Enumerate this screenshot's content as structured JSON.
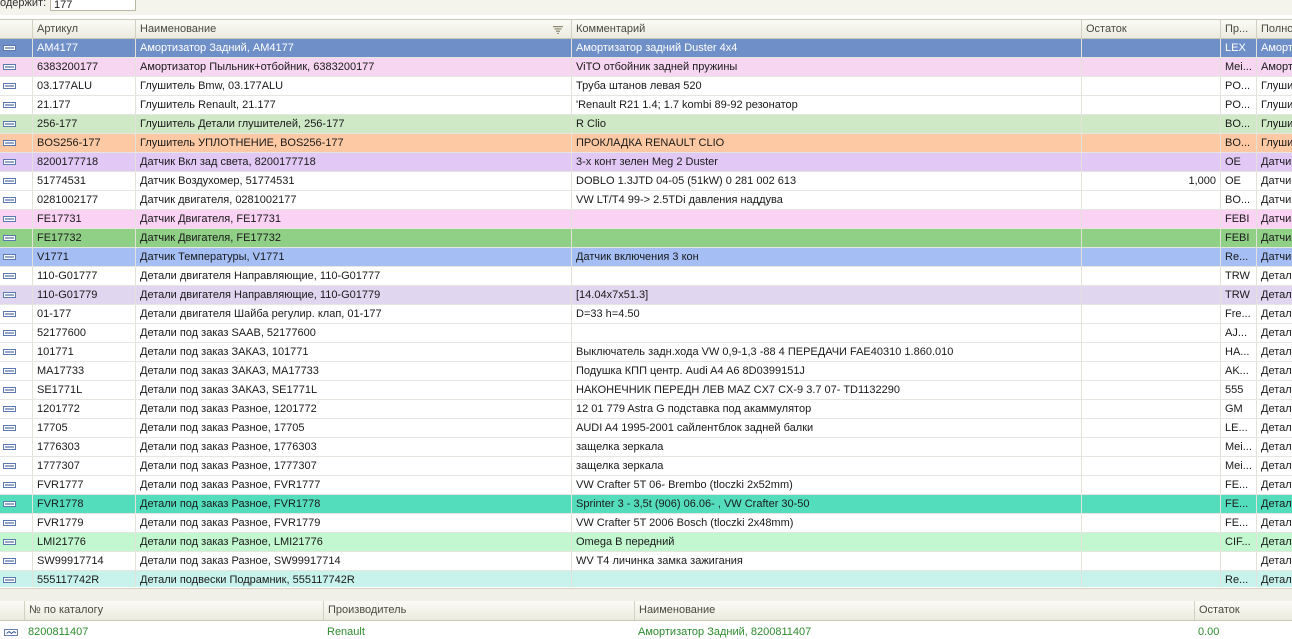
{
  "filter": {
    "label": "одержит:",
    "value": "177"
  },
  "columns": [
    "Артикул",
    "Наименование",
    "Комментарий",
    "Остаток",
    "Пр...",
    "Полно"
  ],
  "rows": [
    {
      "art": "AM4177",
      "name": "Амортизатор Задний, AM4177",
      "comment": "Амортизатор задний Duster 4x4",
      "stock": "",
      "mfr": "LEX",
      "full": "Аморт",
      "color": "#6f8fc8",
      "selected": true
    },
    {
      "art": "6383200177",
      "name": "Амортизатор Пыльник+отбойник, 6383200177",
      "comment": "ViTO отбойник задней пружины",
      "stock": "",
      "mfr": "Mei...",
      "full": "Аморт",
      "color": "#f6d6f1"
    },
    {
      "art": "03.177ALU",
      "name": "Глушитель Bmw, 03.177ALU",
      "comment": "Труба штанов левая 520",
      "stock": "",
      "mfr": "PO...",
      "full": "Глуши",
      "color": "#ffffff"
    },
    {
      "art": "21.177",
      "name": "Глушитель Renault, 21.177",
      "comment": "'Renault R21 1.4; 1.7 kombi  89-92 резонатор",
      "stock": "",
      "mfr": "PO...",
      "full": "Глуши",
      "color": "#ffffff"
    },
    {
      "art": "256-177",
      "name": "Глушитель Детали глушителей, 256-177",
      "comment": "R Clio",
      "stock": "",
      "mfr": "BO...",
      "full": "Глуши",
      "color": "#cfe8c6"
    },
    {
      "art": "BOS256-177",
      "name": "Глушитель УПЛОТНЕНИЕ, BOS256-177",
      "comment": "ПРОКЛАДКА RENAULT CLIO",
      "stock": "",
      "mfr": "BO...",
      "full": "Глуши",
      "color": "#fdc9a4"
    },
    {
      "art": "8200177718",
      "name": "Датчик Вкл зад света, 8200177718",
      "comment": "3-х конт зелен Meg 2  Duster",
      "stock": "",
      "mfr": "OE",
      "full": "Датчи",
      "color": "#e2c9f5"
    },
    {
      "art": "51774531",
      "name": "Датчик Воздухомер, 51774531",
      "comment": "DOBLO 1.3JTD 04-05 (51kW) 0 281 002 613",
      "stock": "1,000",
      "mfr": "OE",
      "full": "Датчи",
      "color": "#ffffff"
    },
    {
      "art": "0281002177",
      "name": "Датчик двигателя, 0281002177",
      "comment": "VW LT/T4  99-> 2.5TDi давления наддува",
      "stock": "",
      "mfr": "BO...",
      "full": "Датчи",
      "color": "#ffffff"
    },
    {
      "art": "FE17731",
      "name": "Датчик Двигателя, FE17731",
      "comment": "",
      "stock": "",
      "mfr": "FEBI",
      "full": "Датчи",
      "color": "#fad2f4"
    },
    {
      "art": "FE17732",
      "name": "Датчик Двигателя, FE17732",
      "comment": "",
      "stock": "",
      "mfr": "FEBI",
      "full": "Датчи",
      "color": "#8fcf86"
    },
    {
      "art": "V1771",
      "name": "Датчик Температуры, V1771",
      "comment": "Датчик  включения 3 кон",
      "stock": "",
      "mfr": "Re...",
      "full": "Датчи",
      "color": "#a5bff5"
    },
    {
      "art": "110-G01777",
      "name": "Детали двигателя Направляющие, 110-G01777",
      "comment": "",
      "stock": "",
      "mfr": "TRW",
      "full": "Детал",
      "color": "#ffffff"
    },
    {
      "art": "110-G01779",
      "name": "Детали двигателя Направляющие, 110-G01779",
      "comment": "[14.04x7x51.3]",
      "stock": "",
      "mfr": "TRW",
      "full": "Детал",
      "color": "#e0d6ef"
    },
    {
      "art": "01-177",
      "name": "Детали двигателя Шайба регулир. клап, 01-177",
      "comment": "D=33 h=4.50",
      "stock": "",
      "mfr": "Fre...",
      "full": "Детал",
      "color": "#ffffff"
    },
    {
      "art": "52177600",
      "name": "Детали под заказ SAAB, 52177600",
      "comment": "",
      "stock": "",
      "mfr": "AJ...",
      "full": "Детал",
      "color": "#ffffff"
    },
    {
      "art": "101771",
      "name": "Детали под заказ ЗАКАЗ, 101771",
      "comment": "Выключатель задн.хода VW 0,9-1,3 -88 4 ПЕРЕДАЧИ   FAE40310   1.860.010",
      "stock": "",
      "mfr": "HA...",
      "full": "Детал",
      "color": "#ffffff"
    },
    {
      "art": "MA17733",
      "name": "Детали под заказ ЗАКАЗ, MA17733",
      "comment": "Подушка КПП центр. Audi A4 A6  8D0399151J",
      "stock": "",
      "mfr": "AK...",
      "full": "Детал",
      "color": "#ffffff"
    },
    {
      "art": "SE1771L",
      "name": "Детали под заказ ЗАКАЗ, SE1771L",
      "comment": "НАКОНЕЧНИК ПЕРЕДН ЛЕВ MAZ CX7  CX-9 3.7 07-  TD1132290",
      "stock": "",
      "mfr": "555",
      "full": "Детал",
      "color": "#ffffff"
    },
    {
      "art": "1201772",
      "name": "Детали под заказ Разное, 1201772",
      "comment": "12 01 779 Astra G подставка под акаммулятор",
      "stock": "",
      "mfr": "GM",
      "full": "Детал",
      "color": "#ffffff"
    },
    {
      "art": "17705",
      "name": "Детали под заказ Разное, 17705",
      "comment": "AUDI A4 1995-2001 сайлентблок задней балки",
      "stock": "",
      "mfr": "LE...",
      "full": "Детал",
      "color": "#ffffff"
    },
    {
      "art": "1776303",
      "name": "Детали под заказ Разное, 1776303",
      "comment": "защелка зеркала",
      "stock": "",
      "mfr": "Mei...",
      "full": "Детал",
      "color": "#ffffff"
    },
    {
      "art": "1777307",
      "name": "Детали под заказ Разное, 1777307",
      "comment": "защелка зеркала",
      "stock": "",
      "mfr": "Mei...",
      "full": "Детал",
      "color": "#ffffff"
    },
    {
      "art": "FVR1777",
      "name": "Детали под заказ Разное, FVR1777",
      "comment": " VW Crafter 5T 06- Brembo (tloczki 2x52mm)",
      "stock": "",
      "mfr": "FE...",
      "full": "Детал",
      "color": "#ffffff"
    },
    {
      "art": "FVR1778",
      "name": "Детали под заказ Разное, FVR1778",
      "comment": "Sprinter 3 - 3,5t (906) 06.06- , VW Crafter 30-50",
      "stock": "",
      "mfr": "FE...",
      "full": "Детал",
      "color": "#54ddbd"
    },
    {
      "art": "FVR1779",
      "name": "Детали под заказ Разное, FVR1779",
      "comment": "VW Crafter  5T 2006 Bosch (tloczki 2x48mm)",
      "stock": "",
      "mfr": "FE...",
      "full": "Детал",
      "color": "#ffffff"
    },
    {
      "art": "LMI21776",
      "name": "Детали под заказ Разное, LMI21776",
      "comment": "Omega B передний",
      "stock": "",
      "mfr": "CIF...",
      "full": "Детал",
      "color": "#c3f7cf"
    },
    {
      "art": "SW99917714",
      "name": "Детали под заказ Разное, SW99917714",
      "comment": "WV T4 личинка замка зажигания",
      "stock": "",
      "mfr": "",
      "full": "Детал",
      "color": "#ffffff"
    },
    {
      "art": "555117742R",
      "name": "Детали подвески Подрамник, 555117742R",
      "comment": "",
      "stock": "",
      "mfr": "Re...",
      "full": "Детал",
      "color": "#c8f3ec"
    }
  ],
  "bottom": {
    "columns": [
      "№ по каталогу",
      "Производитель",
      "Наименование",
      "Остаток"
    ],
    "row": {
      "catalog": "8200811407",
      "mfr": "Renault",
      "name": "Амортизатор Задний, 8200811407",
      "stock": "0.00"
    }
  },
  "colors": {
    "selected_row": "#6f8fc8",
    "bottom_text": "#2e8b2e"
  },
  "icons": {
    "row": "row-marker-icon",
    "sort": "sort-descending-icon",
    "bottom_row": "link-icon"
  }
}
